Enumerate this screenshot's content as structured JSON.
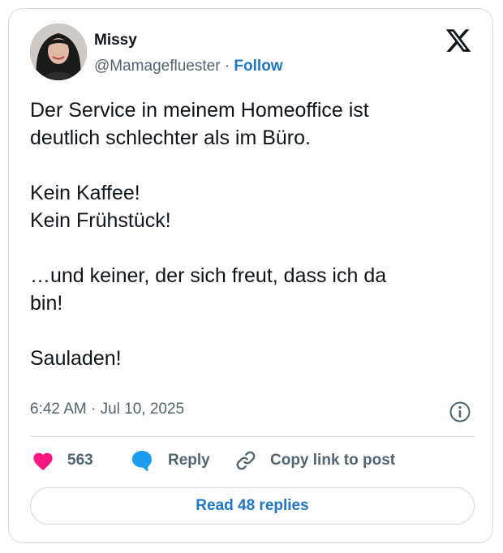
{
  "author": {
    "display_name": "Missy",
    "handle": "@Mamagefluester",
    "separator": "·",
    "follow_label": "Follow"
  },
  "icons": {
    "platform_logo": "x-logo-icon",
    "info": "info-icon",
    "like": "heart-icon",
    "reply": "speech-bubble-icon",
    "copy_link": "link-icon"
  },
  "post": {
    "lines": [
      "Der Service in meinem Homeoffice ist",
      "deutlich schlechter als im Büro.",
      "",
      "Kein Kaffee!",
      "Kein Frühstück!",
      "",
      "…und keiner, der sich freut, dass ich da",
      "bin!",
      "",
      "Sauladen!"
    ],
    "timestamp": "6:42 AM · Jul 10, 2025"
  },
  "actions": {
    "like_count": "563",
    "reply_label": "Reply",
    "copy_link_label": "Copy link to post",
    "read_replies_label": "Read 48 replies"
  },
  "colors": {
    "link_blue": "#1d76c8",
    "like_pink": "#f91880",
    "reply_blue": "#1d9bf0",
    "muted_text": "#536471",
    "border": "#d6dbe0"
  }
}
